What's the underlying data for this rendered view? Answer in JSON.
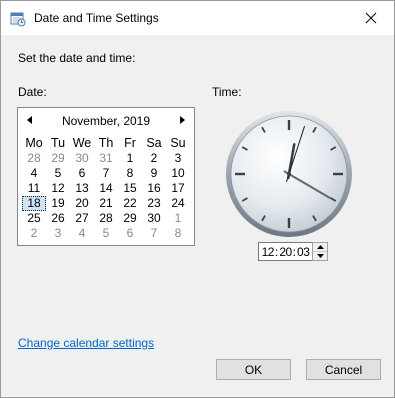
{
  "window": {
    "title": "Date and Time Settings",
    "close_glyph": "✕"
  },
  "heading": "Set the date and time:",
  "date_label": "Date:",
  "time_label": "Time:",
  "calendar": {
    "month_year": "November, 2019",
    "weekdays": [
      "Mo",
      "Tu",
      "We",
      "Th",
      "Fr",
      "Sa",
      "Su"
    ],
    "weeks": [
      [
        {
          "d": "28",
          "other": true
        },
        {
          "d": "29",
          "other": true
        },
        {
          "d": "30",
          "other": true
        },
        {
          "d": "31",
          "other": true
        },
        {
          "d": "1"
        },
        {
          "d": "2"
        },
        {
          "d": "3"
        }
      ],
      [
        {
          "d": "4"
        },
        {
          "d": "5"
        },
        {
          "d": "6"
        },
        {
          "d": "7"
        },
        {
          "d": "8"
        },
        {
          "d": "9"
        },
        {
          "d": "10"
        }
      ],
      [
        {
          "d": "11"
        },
        {
          "d": "12"
        },
        {
          "d": "13"
        },
        {
          "d": "14"
        },
        {
          "d": "15"
        },
        {
          "d": "16"
        },
        {
          "d": "17"
        }
      ],
      [
        {
          "d": "18",
          "selected": true
        },
        {
          "d": "19"
        },
        {
          "d": "20"
        },
        {
          "d": "21"
        },
        {
          "d": "22"
        },
        {
          "d": "23"
        },
        {
          "d": "24"
        }
      ],
      [
        {
          "d": "25"
        },
        {
          "d": "26"
        },
        {
          "d": "27"
        },
        {
          "d": "28"
        },
        {
          "d": "29"
        },
        {
          "d": "30"
        },
        {
          "d": "1",
          "other": true
        }
      ],
      [
        {
          "d": "2",
          "other": true
        },
        {
          "d": "3",
          "other": true
        },
        {
          "d": "4",
          "other": true
        },
        {
          "d": "5",
          "other": true
        },
        {
          "d": "6",
          "other": true
        },
        {
          "d": "7",
          "other": true
        },
        {
          "d": "8",
          "other": true
        }
      ]
    ]
  },
  "clock": {
    "hours": 12,
    "minutes": 20,
    "seconds": 3
  },
  "time": {
    "hours": "12",
    "minutes": "20",
    "seconds": "03"
  },
  "link_label": "Change calendar settings",
  "buttons": {
    "ok": "OK",
    "cancel": "Cancel"
  },
  "colors": {
    "link": "#0066cc",
    "selected_day": "#cce4f7",
    "second_hand": "#1a1a1a"
  }
}
